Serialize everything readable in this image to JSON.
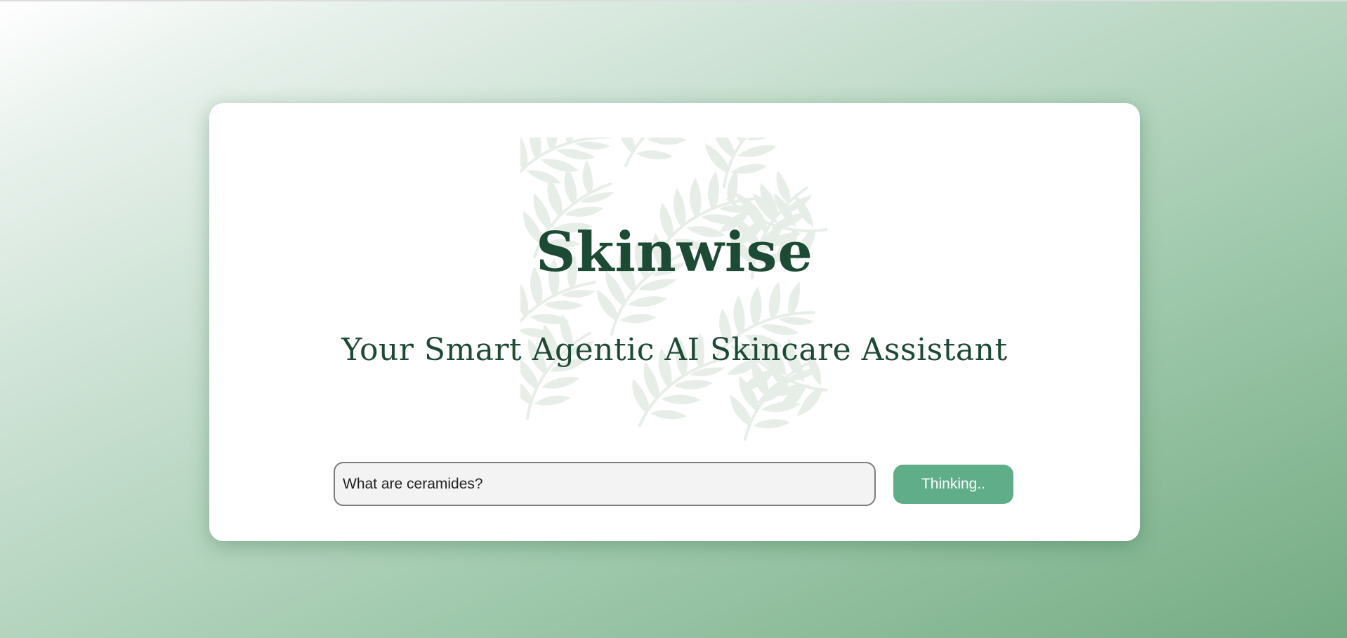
{
  "app": {
    "title": "Skinwise",
    "subtitle": "Your Smart Agentic AI Skincare Assistant"
  },
  "query": {
    "value": "What are ceramides?"
  },
  "submit": {
    "label": "Thinking.."
  },
  "colors": {
    "title_text": "#1d4a35",
    "button": "#5fae89",
    "card": "#ffffff",
    "background_light": "#ffffff",
    "background_dark": "#74ab83"
  },
  "icons": {
    "background_pattern": "palm-leaf-pattern"
  }
}
